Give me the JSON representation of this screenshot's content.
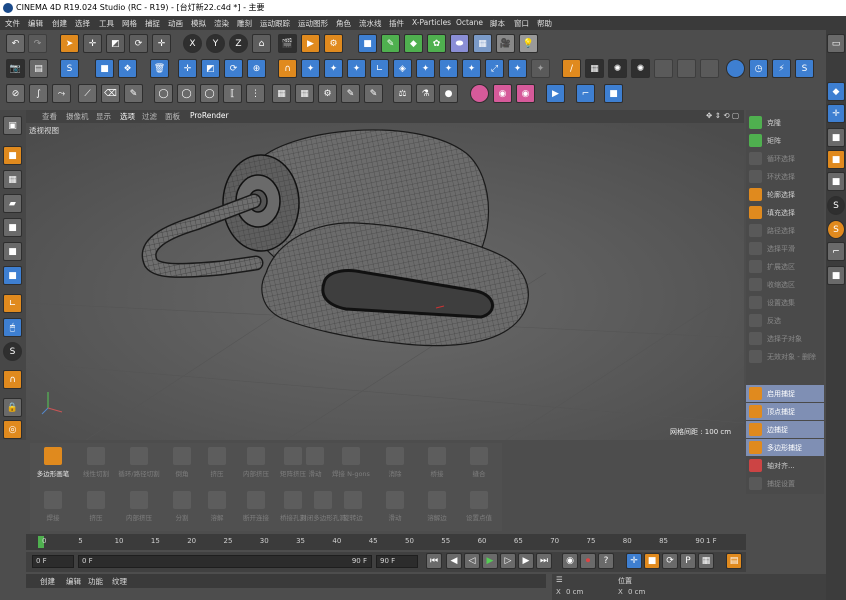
{
  "window": {
    "title": "CINEMA 4D R19.024 Studio (RC - R19) - [台灯新22.c4d *] - 主要"
  },
  "menu": [
    "文件",
    "编辑",
    "创建",
    "选择",
    "工具",
    "网格",
    "捕捉",
    "动画",
    "模拟",
    "渲染",
    "雕刻",
    "运动跟踪",
    "运动图形",
    "角色",
    "流水线",
    "插件",
    "X-Particles",
    "Octane",
    "脚本",
    "窗口",
    "帮助"
  ],
  "viewport": {
    "menu": [
      "查看",
      "摄像机",
      "显示",
      "选项",
      "过滤",
      "面板",
      "ProRender"
    ],
    "view_name": "透视视图",
    "grid_spacing": "网格间距 : 100 cm"
  },
  "right_panel": {
    "items": [
      {
        "label": "克隆",
        "state": "normal"
      },
      {
        "label": "矩阵",
        "state": "normal"
      },
      {
        "label": "循环选择",
        "state": "dim"
      },
      {
        "label": "环状选择",
        "state": "dim"
      },
      {
        "label": "轮廓选择",
        "state": "normal"
      },
      {
        "label": "填充选择",
        "state": "normal"
      },
      {
        "label": "路径选择",
        "state": "dim"
      },
      {
        "label": "选择平滑",
        "state": "dim"
      },
      {
        "label": "扩展选区",
        "state": "dim"
      },
      {
        "label": "收缩选区",
        "state": "dim"
      },
      {
        "label": "设置选集",
        "state": "dim"
      },
      {
        "label": "反选",
        "state": "dim"
      },
      {
        "label": "选择子对象",
        "state": "dim"
      },
      {
        "label": "无效对象 - 删除",
        "state": "dim"
      },
      {
        "label": "启用捕捉",
        "state": "highlight"
      },
      {
        "label": "顶点捕捉",
        "state": "highlight"
      },
      {
        "label": "边捕捉",
        "state": "highlight"
      },
      {
        "label": "多边形捕捉",
        "state": "highlight"
      },
      {
        "label": "轴对齐...",
        "state": "normal"
      },
      {
        "label": "捕捉设置",
        "state": "dim"
      }
    ]
  },
  "tool_panel": {
    "row1": [
      "多边形画笔",
      "线性切割",
      "循环/路径切割",
      "倒角",
      "挤压",
      "内部挤压",
      "矩阵挤压",
      "滑动",
      "焊接 N-gons",
      "消除",
      "桥接",
      "缝合"
    ],
    "row2": [
      "焊接",
      "挤压",
      "内部挤压",
      "分割",
      "溶解",
      "断开连接",
      "桥接孔洞",
      "封闭多边形孔洞",
      "旋转边",
      "滑动",
      "溶解边",
      "设置点值"
    ],
    "active": "多边形画笔"
  },
  "timeline": {
    "ticks": [
      "0",
      "5",
      "10",
      "15",
      "20",
      "25",
      "30",
      "35",
      "40",
      "45",
      "50",
      "55",
      "60",
      "65",
      "70",
      "75",
      "80",
      "85",
      "90"
    ],
    "end_frame": "1 F"
  },
  "transport": {
    "start": "0 F",
    "current": "0 F",
    "end": "90 F",
    "max": "90 F"
  },
  "bottom_tabs": [
    "创建",
    "编辑",
    "功能",
    "纹理"
  ],
  "coords": {
    "position_header": "位置",
    "x": "0 cm",
    "xs": "0 cm"
  },
  "colors": {
    "accent": "#e08a1e",
    "blue": "#3e7fd1",
    "highlight": "#7f8fb4"
  }
}
